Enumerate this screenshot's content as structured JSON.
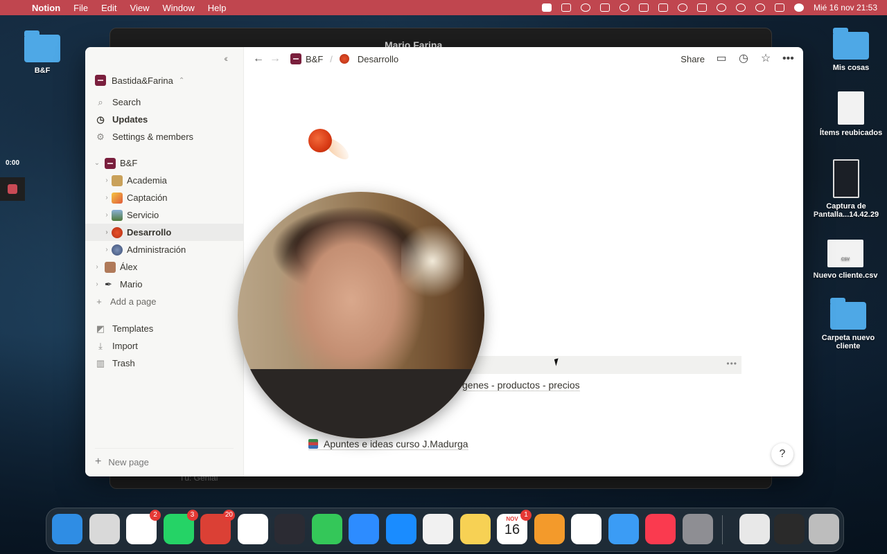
{
  "menubar": {
    "app": "Notion",
    "menus": [
      "File",
      "Edit",
      "View",
      "Window",
      "Help"
    ],
    "datetime": "Mié 16 nov  21:53"
  },
  "desktop": {
    "left_folder": "B&F",
    "right_items": [
      "Mis cosas",
      "Ítems reubicados",
      "Captura de Pantalla...14.42.29",
      "Nuevo cliente.csv",
      "Carpeta nuevo cliente"
    ],
    "csv_tag": "CSV"
  },
  "recorder": {
    "time": "0:00"
  },
  "background_window": {
    "contact": "Mario Farina",
    "footer": "Tú: Genial"
  },
  "sidebar": {
    "workspace": "Bastida&Farina",
    "top_items": [
      {
        "label": "Search",
        "icon": "search-icon"
      },
      {
        "label": "Updates",
        "icon": "clock-icon"
      },
      {
        "label": "Settings & members",
        "icon": "gear-icon"
      }
    ],
    "tree": {
      "root": "B&F",
      "children": [
        "Academia",
        "Captación",
        "Servicio",
        "Desarrollo",
        "Administración"
      ],
      "private": [
        "Álex",
        "Mario"
      ],
      "add_page": "Add a page"
    },
    "bottom_items": [
      {
        "label": "Templates",
        "icon": "templates-icon"
      },
      {
        "label": "Import",
        "icon": "download-icon"
      },
      {
        "label": "Trash",
        "icon": "trash-icon"
      }
    ],
    "new_page": "New page"
  },
  "topbar": {
    "breadcrumb_root": "B&F",
    "breadcrumb_current": "Desarrollo",
    "share": "Share"
  },
  "content": {
    "links": [
      "genes - productos - precios",
      "Apuntes e ideas curso J.Madurga"
    ],
    "help": "?"
  },
  "dock": {
    "apps": [
      {
        "name": "Finder",
        "color": "#2f8de4",
        "badge": ""
      },
      {
        "name": "Launchpad",
        "color": "#d9d9d9",
        "badge": ""
      },
      {
        "name": "Slack",
        "color": "#ffffff",
        "badge": "2"
      },
      {
        "name": "WhatsApp",
        "color": "#25d366",
        "badge": "3"
      },
      {
        "name": "Todoist",
        "color": "#db4035",
        "badge": "20"
      },
      {
        "name": "Notion",
        "color": "#ffffff",
        "badge": ""
      },
      {
        "name": "OBS",
        "color": "#2b2b33",
        "badge": ""
      },
      {
        "name": "FaceTime",
        "color": "#34c759",
        "badge": ""
      },
      {
        "name": "Zoom",
        "color": "#2d8cff",
        "badge": ""
      },
      {
        "name": "Safari",
        "color": "#1a8cff",
        "badge": ""
      },
      {
        "name": "Chrome",
        "color": "#f1f1f1",
        "badge": ""
      },
      {
        "name": "Notes",
        "color": "#f7d154",
        "badge": ""
      },
      {
        "name": "Calendar",
        "color": "#ffffff",
        "badge": "1"
      },
      {
        "name": "Pages",
        "color": "#f39a2b",
        "badge": ""
      },
      {
        "name": "Reeder",
        "color": "#ffffff",
        "badge": ""
      },
      {
        "name": "Mail",
        "color": "#3b9cf5",
        "badge": ""
      },
      {
        "name": "Music",
        "color": "#fa3a4f",
        "badge": ""
      },
      {
        "name": "System Settings",
        "color": "#8e8e93",
        "badge": ""
      }
    ],
    "calendar_month": "NOV",
    "calendar_day": "16"
  }
}
